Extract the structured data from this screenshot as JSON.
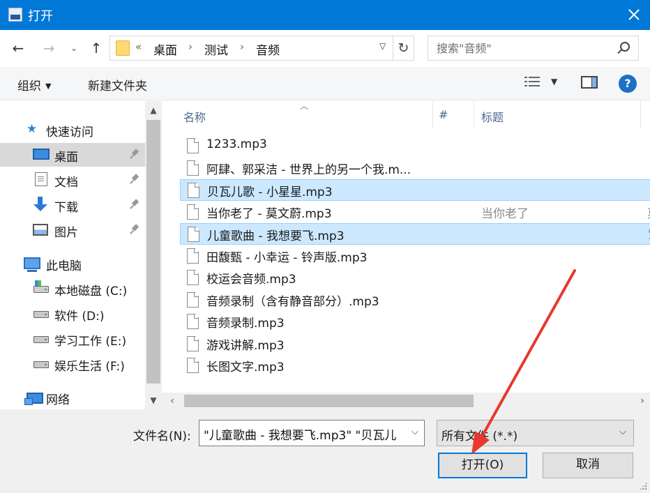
{
  "window": {
    "title": "打开"
  },
  "nav": {
    "breadcrumb": [
      "桌面",
      "测试",
      "音频"
    ],
    "overflow": "«",
    "search_placeholder": "搜索\"音频\""
  },
  "toolbar": {
    "organize": "组织",
    "new_folder": "新建文件夹"
  },
  "sidebar": {
    "items": [
      {
        "label": "快速访问",
        "icon": "star-icon"
      },
      {
        "label": "桌面",
        "icon": "desktop-icon",
        "pinned": true,
        "selected": true
      },
      {
        "label": "文档",
        "icon": "document-icon",
        "pinned": true
      },
      {
        "label": "下载",
        "icon": "download-icon",
        "pinned": true
      },
      {
        "label": "图片",
        "icon": "pictures-icon",
        "pinned": true
      },
      {
        "label": "此电脑",
        "icon": "computer-icon"
      },
      {
        "label": "本地磁盘 (C:)",
        "icon": "drive-icon"
      },
      {
        "label": "软件 (D:)",
        "icon": "drive-icon"
      },
      {
        "label": "学习工作 (E:)",
        "icon": "drive-icon"
      },
      {
        "label": "娱乐生活 (F:)",
        "icon": "drive-icon"
      },
      {
        "label": "网络",
        "icon": "network-icon"
      }
    ]
  },
  "filelist": {
    "columns": [
      "名称",
      "#",
      "标题"
    ],
    "rows": [
      {
        "name": "1233.mp3",
        "title": "",
        "selected": false
      },
      {
        "name": "阿肆、郭采洁 - 世界上的另一个我.m...",
        "title": "",
        "selected": false
      },
      {
        "name": "贝瓦儿歌 - 小星星.mp3",
        "title": "",
        "selected": true
      },
      {
        "name": "当你老了 - 莫文蔚.mp3",
        "title": "当你老了",
        "edge": "莫",
        "selected": false
      },
      {
        "name": "儿童歌曲 - 我想要飞.mp3",
        "title": "",
        "edge": "y",
        "selected": true
      },
      {
        "name": "田馥甄 - 小幸运 - 铃声版.mp3",
        "title": "",
        "selected": false
      },
      {
        "name": "校运会音频.mp3",
        "title": "",
        "selected": false
      },
      {
        "name": "音频录制（含有静音部分）.mp3",
        "title": "",
        "selected": false
      },
      {
        "name": "音频录制.mp3",
        "title": "",
        "selected": false
      },
      {
        "name": "游戏讲解.mp3",
        "title": "",
        "selected": false
      },
      {
        "name": "长图文字.mp3",
        "title": "",
        "selected": false
      }
    ]
  },
  "footer": {
    "filename_label": "文件名(N):",
    "filename_value": "\"儿童歌曲 - 我想要飞.mp3\" \"贝瓦儿",
    "filter_label": "所有文件 (*.*)",
    "open_button": "打开(O)",
    "cancel_button": "取消"
  },
  "colors": {
    "titlebar": "#0078d7",
    "selection": "#cce8ff",
    "annotation_arrow": "#e8382f"
  }
}
